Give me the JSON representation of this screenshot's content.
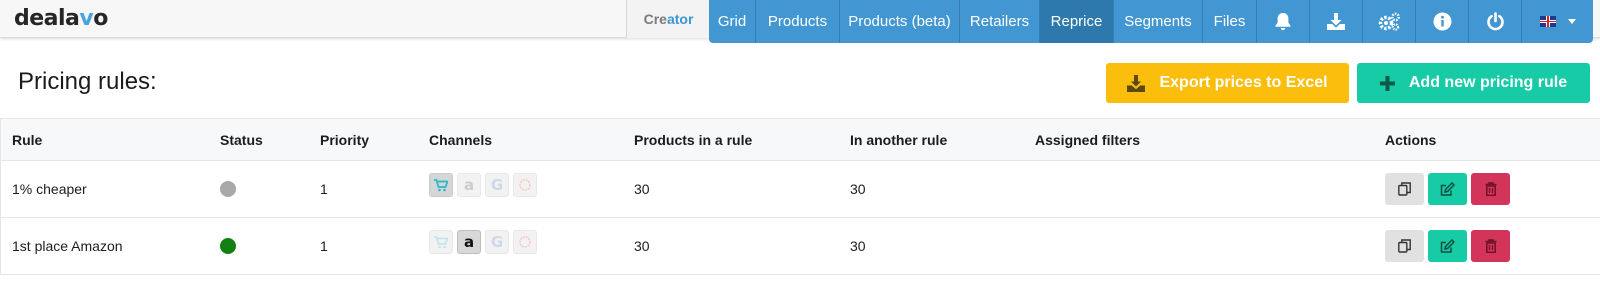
{
  "brand": {
    "logo_pre": "deala",
    "logo_v": "v",
    "logo_post": "o"
  },
  "creator": {
    "part1": "Cre",
    "part2": "ator"
  },
  "nav": {
    "items": [
      {
        "label": "Grid",
        "active": false
      },
      {
        "label": "Products",
        "active": false
      },
      {
        "label": "Products (beta)",
        "active": false
      },
      {
        "label": "Retailers",
        "active": false
      },
      {
        "label": "Reprice",
        "active": true
      },
      {
        "label": "Segments",
        "active": false
      },
      {
        "label": "Files",
        "active": false
      }
    ],
    "icons": [
      "bell-icon",
      "download-icon",
      "gears-icon",
      "info-icon",
      "power-icon"
    ],
    "language": "uk-flag-icon"
  },
  "page": {
    "title": "Pricing rules:",
    "export_label": "Export prices to Excel",
    "add_label": "Add new pricing rule"
  },
  "table": {
    "headers": {
      "rule": "Rule",
      "status": "Status",
      "priority": "Priority",
      "channels": "Channels",
      "products": "Products in a rule",
      "another": "In another rule",
      "filters": "Assigned filters",
      "actions": "Actions"
    },
    "rows": [
      {
        "rule": "1% cheaper",
        "status": "inactive",
        "priority": "1",
        "products": "30",
        "another": "30",
        "filters": "",
        "channels_active": {
          "shop": true,
          "amazon": false,
          "google": false,
          "other": false
        }
      },
      {
        "rule": "1st place Amazon",
        "status": "active",
        "priority": "1",
        "products": "30",
        "another": "30",
        "filters": "",
        "channels_active": {
          "shop": false,
          "amazon": true,
          "google": false,
          "other": false
        }
      }
    ]
  },
  "colors": {
    "nav_blue": "#4297d3",
    "export_yellow": "#fbbe0d",
    "add_green": "#17cba6",
    "delete_red": "#d33459",
    "status_inactive": "#a9a9a9",
    "status_active": "#128012"
  }
}
